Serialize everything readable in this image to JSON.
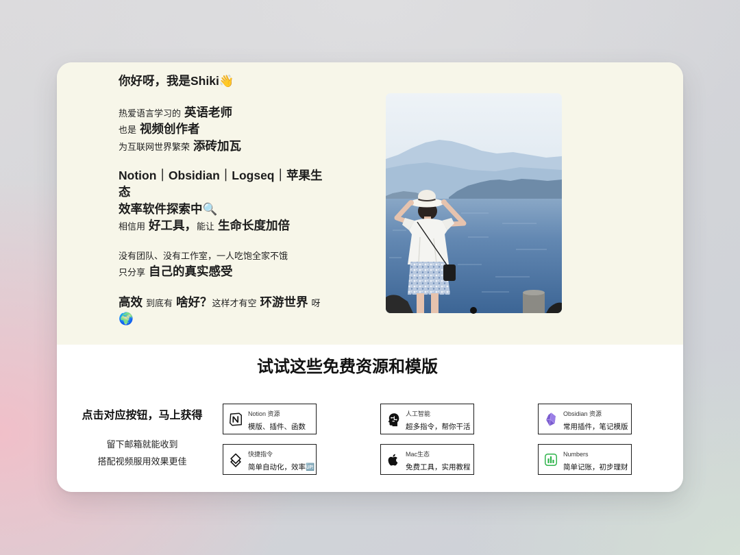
{
  "intro": {
    "greeting": "你好呀，我是Shiki👋",
    "about": [
      {
        "lead": "热爱语言学习的",
        "highlight": "英语老师"
      },
      {
        "lead": "也是",
        "highlight": "视频创作者"
      },
      {
        "lead": "为互联网世界繁荣",
        "highlight": "添砖加瓦"
      }
    ],
    "tools": "Notion｜Obsidian｜Logseq｜苹果生态",
    "exploring": "效率软件探索中🔍",
    "belief": {
      "a": "相信用",
      "b": "好工具，",
      "c": "能让",
      "d": "生命长度加倍"
    },
    "solo": "没有团队、没有工作室，一人吃饱全家不饿",
    "share": {
      "lead": "只分享",
      "highlight": "自己的真实感受"
    },
    "travel": {
      "a": "高效",
      "b": "到底有",
      "c": "啥好？",
      "d": "这样才有空",
      "e": "环游世界",
      "f": "呀",
      "emoji": "🌍"
    }
  },
  "resources": {
    "title": "试试这些免费资源和模版",
    "cta": "点击对应按钮，马上获得",
    "note_lines": [
      "留下邮箱就能收到",
      "搭配视频服用效果更佳"
    ],
    "buttons": [
      {
        "icon": "notion-icon",
        "title": "Notion 资源",
        "subtitle": "模版、插件、函数"
      },
      {
        "icon": "ai-head-icon",
        "title": "人工智能",
        "subtitle": "超多指令，帮你干活"
      },
      {
        "icon": "obsidian-icon",
        "title": "Obsidian 资源",
        "subtitle": "常用插件，笔记模版"
      },
      {
        "icon": "shortcuts-icon",
        "title": "快捷指令",
        "subtitle": "简单自动化，效率🆙"
      },
      {
        "icon": "apple-icon",
        "title": "Mac生态",
        "subtitle": "免费工具，实用教程"
      },
      {
        "icon": "numbers-icon",
        "title": "Numbers",
        "subtitle": "简单记账，初步理财"
      }
    ]
  },
  "colors": {
    "hero_background": "#f7f6e9",
    "text": "#1c1c1c",
    "button_border": "#1a1a1a",
    "obsidian_purple": "#7b5dcf",
    "numbers_green": "#2db34a"
  }
}
